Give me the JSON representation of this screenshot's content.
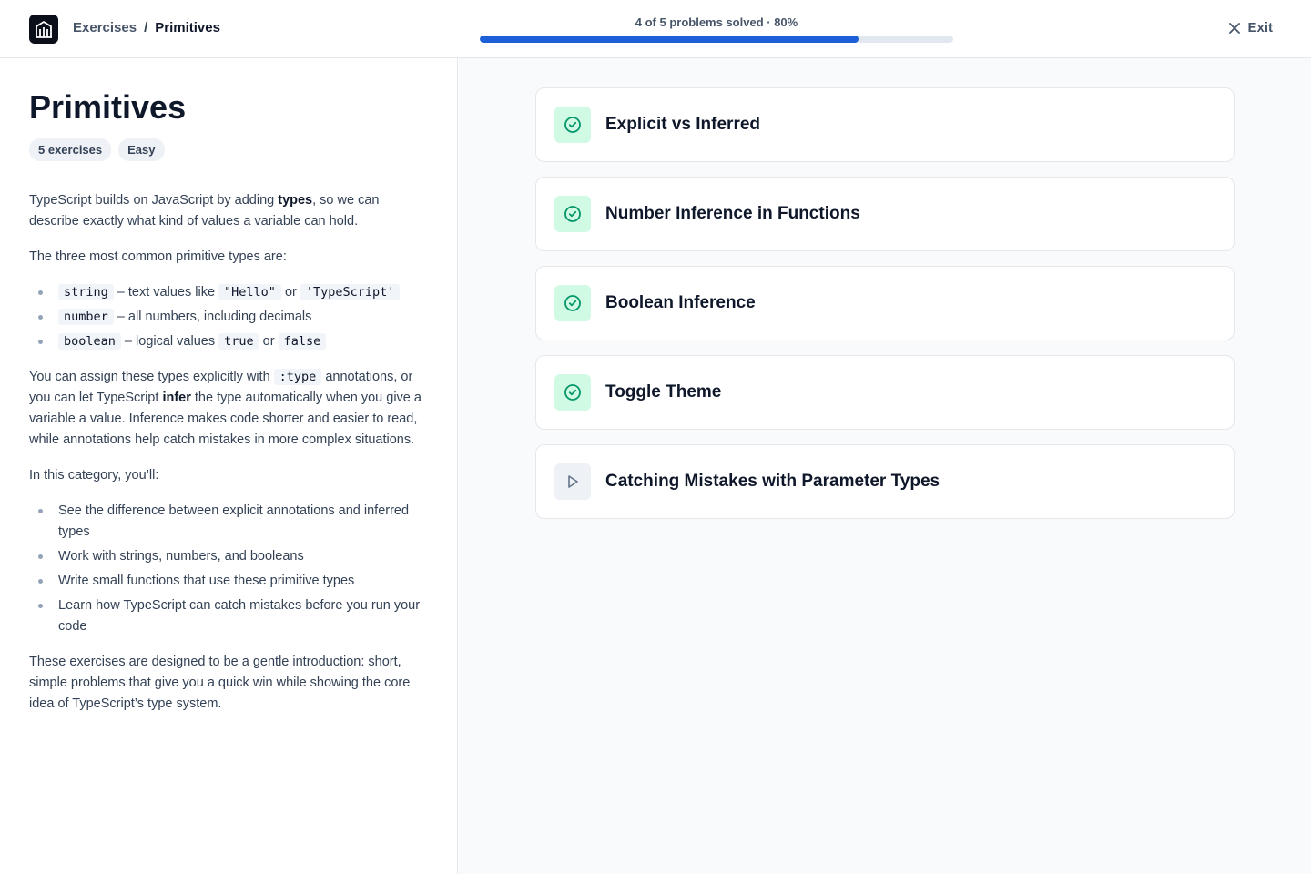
{
  "header": {
    "breadcrumb": {
      "parent": "Exercises",
      "separator": "/",
      "current": "Primitives"
    },
    "progress": {
      "text": "4 of 5 problems solved · 80%",
      "solved": 4,
      "total": 5,
      "percent": 80
    },
    "exit_label": "Exit",
    "logo_icon": "building-icon"
  },
  "category": {
    "title": "Primitives",
    "tags": [
      "5 exercises",
      "Easy"
    ],
    "intro_pre": "TypeScript builds on JavaScript by adding ",
    "intro_bold": "types",
    "intro_post": ", so we can describe exactly what kind of values a variable can hold.",
    "types_heading": "The three most common primitive types are:",
    "types": [
      {
        "code": "string",
        "text_pre": " – text values like ",
        "ex1": "\"Hello\"",
        "mid": " or ",
        "ex2": "'TypeScript'"
      },
      {
        "code": "number",
        "text_pre": " – all numbers, including decimals"
      },
      {
        "code": "boolean",
        "text_pre": " – logical values ",
        "ex1": "true",
        "mid": " or ",
        "ex2": "false"
      }
    ],
    "assign_pre": "You can assign these types explicitly with ",
    "assign_code": ":type",
    "assign_mid": " annotations, or you can let TypeScript ",
    "assign_bold": "infer",
    "assign_post": " the type automatically when you give a variable a value. Inference makes code shorter and easier to read, while annotations help catch mistakes in more complex situations.",
    "goals_heading": "In this category, you’ll:",
    "goals": [
      "See the difference between explicit annotations and inferred types",
      "Work with strings, numbers, and booleans",
      "Write small functions that use these primitive types",
      "Learn how TypeScript can catch mistakes before you run your code"
    ],
    "closing": "These exercises are designed to be a gentle introduction: short, simple problems that give you a quick win while showing the core idea of TypeScript’s type system."
  },
  "problems": [
    {
      "title": "Explicit vs Inferred",
      "status": "solved",
      "icon": "check-circle-icon"
    },
    {
      "title": "Number Inference in Functions",
      "status": "solved",
      "icon": "check-circle-icon"
    },
    {
      "title": "Boolean Inference",
      "status": "solved",
      "icon": "check-circle-icon"
    },
    {
      "title": "Toggle Theme",
      "status": "solved",
      "icon": "check-circle-icon"
    },
    {
      "title": "Catching Mistakes with Parameter Types",
      "status": "unsolved",
      "icon": "play-icon"
    }
  ],
  "colors": {
    "accent": "#1d5fd6",
    "success": "#059669",
    "success_bg": "#d1fae5"
  }
}
